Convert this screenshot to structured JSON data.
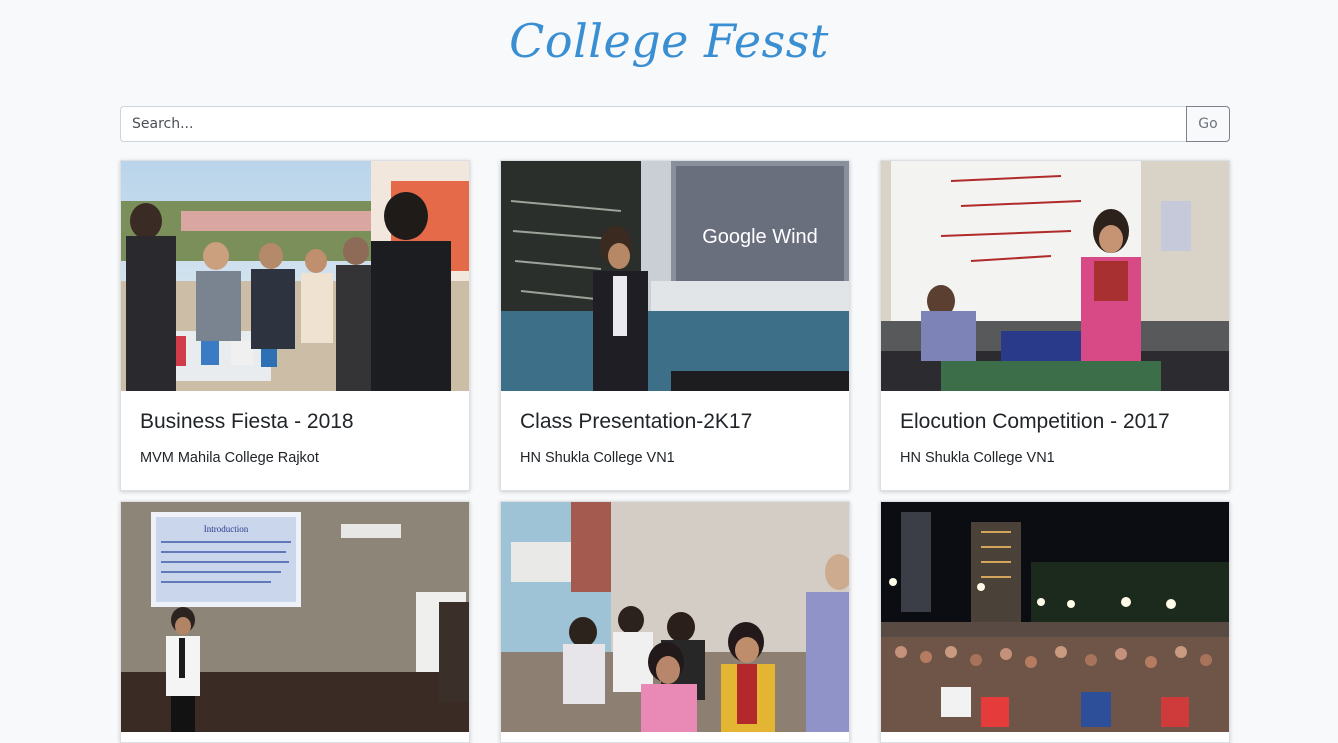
{
  "header": {
    "brand": "College Fesst"
  },
  "search": {
    "placeholder": "Search...",
    "value": "",
    "button_label": "Go"
  },
  "events": [
    {
      "title": "Business Fiesta - 2018",
      "college": "MVM Mahila College Rajkot",
      "photo": "outdoor-stall-photo"
    },
    {
      "title": "Class Presentation-2K17",
      "college": "HN Shukla College VN1",
      "photo": "classroom-projector-photo",
      "photo_text": "Google Wind"
    },
    {
      "title": "Elocution Competition - 2017",
      "college": "HN Shukla College VN1",
      "photo": "speaker-whiteboard-photo"
    },
    {
      "title": "",
      "college": "",
      "photo": "seminar-presentation-photo",
      "photo_text": "Introduction"
    },
    {
      "title": "",
      "college": "",
      "photo": "students-classroom-photo"
    },
    {
      "title": "",
      "college": "",
      "photo": "night-crowd-event-photo"
    }
  ]
}
